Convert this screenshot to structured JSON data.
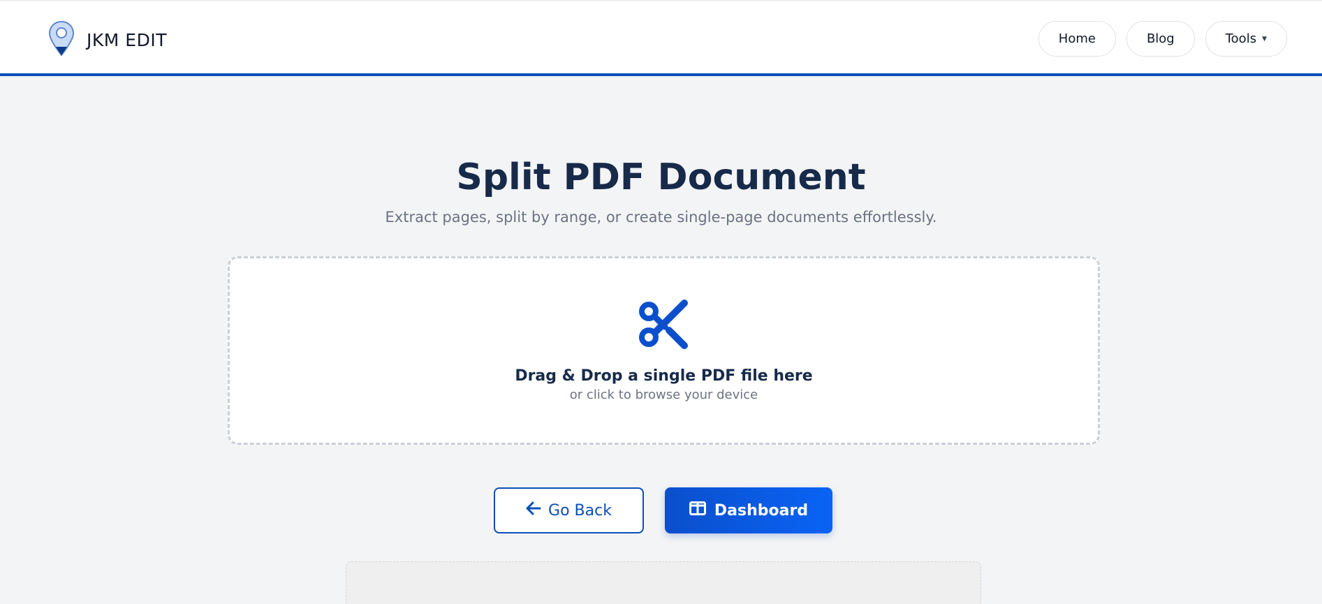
{
  "header": {
    "brand_name": "JKM EDIT",
    "logo_icon": "map-pin-icon",
    "nav": [
      {
        "label": "Home"
      },
      {
        "label": "Blog"
      },
      {
        "label": "Tools",
        "has_dropdown": true
      }
    ]
  },
  "main": {
    "title": "Split PDF Document",
    "subtitle": "Extract pages, split by range, or create single-page documents effortlessly.",
    "dropzone": {
      "icon": "scissors-icon",
      "title": "Drag & Drop a single PDF file here",
      "subtitle": "or click to browse your device"
    },
    "buttons": {
      "back_label": "Go Back",
      "dashboard_label": "Dashboard"
    }
  },
  "colors": {
    "accent": "#0b4fb8",
    "title": "#172a4a",
    "background": "#f3f4f6"
  }
}
